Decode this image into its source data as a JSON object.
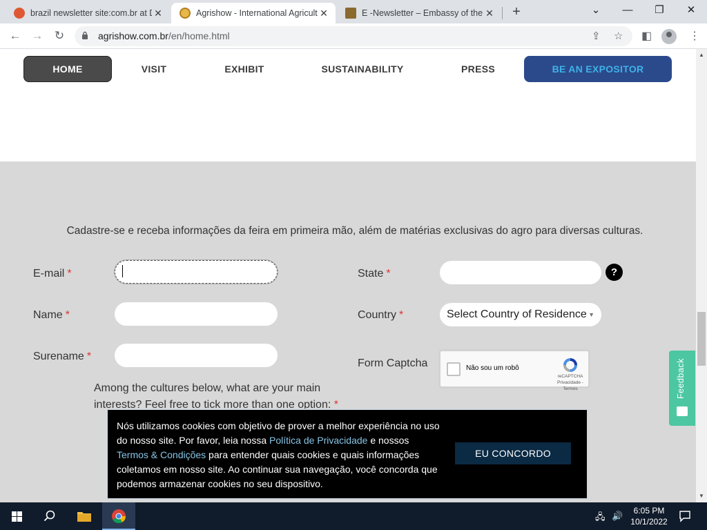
{
  "browser": {
    "tabs": [
      {
        "title": "brazil newsletter site:com.br at D",
        "active": false
      },
      {
        "title": "Agrishow - International Agricult",
        "active": true
      },
      {
        "title": "E -Newsletter – Embassy of the R",
        "active": false
      }
    ],
    "url_host": "agrishow.com.br",
    "url_path": "/en/home.html"
  },
  "nav": {
    "items": [
      "HOME",
      "VISIT",
      "EXHIBIT",
      "SUSTAINABILITY",
      "PRESS"
    ],
    "cta": "BE AN EXPOSITOR"
  },
  "form": {
    "intro": "Cadastre-se e receba informações da feira em primeira mão, além de matérias exclusivas do agro para diversas culturas.",
    "required_mark": "*",
    "email_label": "E-mail",
    "name_label": "Name",
    "surename_label": "Surename",
    "state_label": "State",
    "country_label": "Country",
    "country_selected": "Select Country of Residence",
    "captcha_label": "Form Captcha",
    "captcha_text": "Não sou um robô",
    "captcha_brand": "reCAPTCHA",
    "captcha_links": "Privacidade - Termos",
    "help_glyph": "?",
    "interests_text": "Among the cultures below, what are your main interests? Feel free to tick more than one option:"
  },
  "feedback": {
    "label": "Feedback"
  },
  "cookie": {
    "part1": "Nós utilizamos cookies com objetivo de prover a melhor experiência no uso do nosso site. Por favor, leia nossa ",
    "privacy_link": "Política de Privacidade",
    "part2": " e nossos ",
    "terms_link": "Termos & Condições",
    "part3": " para entender quais cookies e quais informações coletamos em nosso site. Ao continuar sua navegação, você concorda que podemos armazenar cookies no seu dispositivo.",
    "agree": "EU CONCORDO"
  },
  "taskbar": {
    "time": "6:05 PM",
    "date": "10/1/2022"
  },
  "colors": {
    "nav_home_bg": "#4a4a4a",
    "cta_bg": "#2b4a8b",
    "cta_text": "#3fb2e8",
    "form_bg": "#d8d8d8",
    "feedback_bg": "#4cc7a1",
    "required": "#d33333",
    "cookie_link": "#87c5e6"
  }
}
